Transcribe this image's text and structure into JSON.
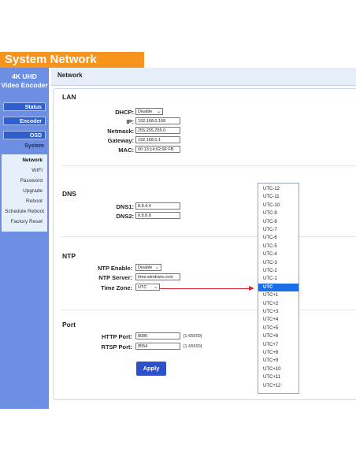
{
  "header": {
    "title": "System Network",
    "bg": "#f7941d"
  },
  "sidebar": {
    "brand_line1": "4K UHD",
    "brand_line2": "Video Encoder",
    "nav": {
      "status": "Status",
      "encoder": "Encoder",
      "osd": "OSD",
      "system": "System"
    },
    "submenu": [
      "Network",
      "WIFI",
      "Password",
      "Upgrade",
      "Reboot",
      "Schedule Reboot",
      "Factory Reset"
    ]
  },
  "page": {
    "title": "Network",
    "lan": {
      "heading": "LAN",
      "dhcp_label": "DHCP:",
      "dhcp_value": "Disable",
      "ip_label": "IP:",
      "ip_value": "192.168.0.168",
      "netmask_label": "Netmask:",
      "netmask_value": "255.255.255.0",
      "gateway_label": "Gateway:",
      "gateway_value": "192.168.0.1",
      "mac_label": "MAC:",
      "mac_value": "00:13:14:02:9F:FB"
    },
    "dns": {
      "heading": "DNS",
      "dns1_label": "DNS1:",
      "dns1_value": "8.8.4.4",
      "dns2_label": "DNS2:",
      "dns2_value": "8.8.8.8"
    },
    "ntp": {
      "heading": "NTP",
      "enable_label": "NTP Enable:",
      "enable_value": "Disable",
      "server_label": "NTP Server:",
      "server_value": "time.windows.com",
      "tz_label": "Time Zone:",
      "tz_value": "UTC"
    },
    "port": {
      "heading": "Port",
      "http_label": "HTTP Port:",
      "http_value": "8086",
      "http_range": "[1-65500]",
      "rtsp_label": "RTSP Port:",
      "rtsp_value": "8554",
      "rtsp_range": "[1-65500]"
    },
    "apply_label": "Apply"
  },
  "timezone_options": [
    "UTC-12",
    "UTC-11",
    "UTC-10",
    "UTC-9",
    "UTC-8",
    "UTC-7",
    "UTC-6",
    "UTC-5",
    "UTC-4",
    "UTC-3",
    "UTC-2",
    "UTC-1",
    "UTC",
    "UTC+1",
    "UTC+2",
    "UTC+3",
    "UTC+4",
    "UTC+5",
    "UTC+6",
    "UTC+7",
    "UTC+8",
    "UTC+9",
    "UTC+10",
    "UTC+11",
    "UTC+12"
  ],
  "timezone_selected": "UTC",
  "colors": {
    "accent": "#2b50c9",
    "sidebar": "#6d8fe3",
    "highlight": "#1a6ee8",
    "arrow": "#d9242b"
  }
}
